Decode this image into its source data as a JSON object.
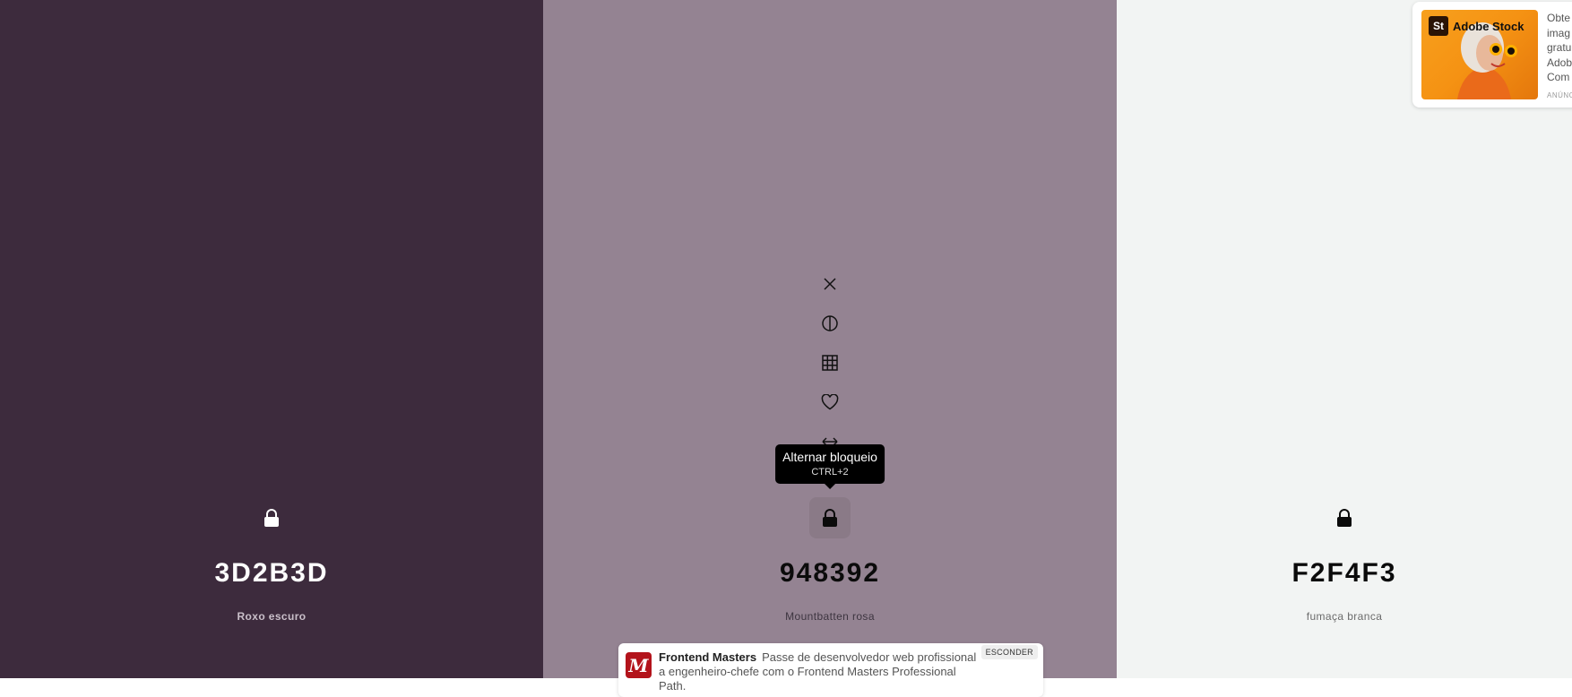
{
  "swatches": [
    {
      "hex": "3D2B3D",
      "name": "Roxo escuro",
      "color": "#3D2B3D",
      "theme": "dark"
    },
    {
      "hex": "948392",
      "name": "Mountbatten rosa",
      "color": "#948392",
      "theme": "light"
    },
    {
      "hex": "F2F4F3",
      "name": "fumaça branca",
      "color": "#F2F4F3",
      "theme": "light"
    }
  ],
  "tools": [
    "close-icon",
    "contrast-icon",
    "grid-icon",
    "heart-icon",
    "drag-horizontal-icon",
    "lock-icon"
  ],
  "tooltip": {
    "title": "Alternar bloqueio",
    "shortcut": "CTRL+2"
  },
  "ads": {
    "stock": {
      "brand": "Adobe Stock",
      "logo_letters": "St",
      "text_lines": [
        "Obte",
        "imag",
        "gratu",
        "Adob",
        "Com"
      ],
      "label": "ANÚNC"
    },
    "frontend": {
      "brand": "Frontend Masters",
      "text": "Passe de desenvolvedor web profissional a engenheiro-chefe com o Frontend Masters Professional Path.",
      "hide": "ESCONDER"
    }
  }
}
